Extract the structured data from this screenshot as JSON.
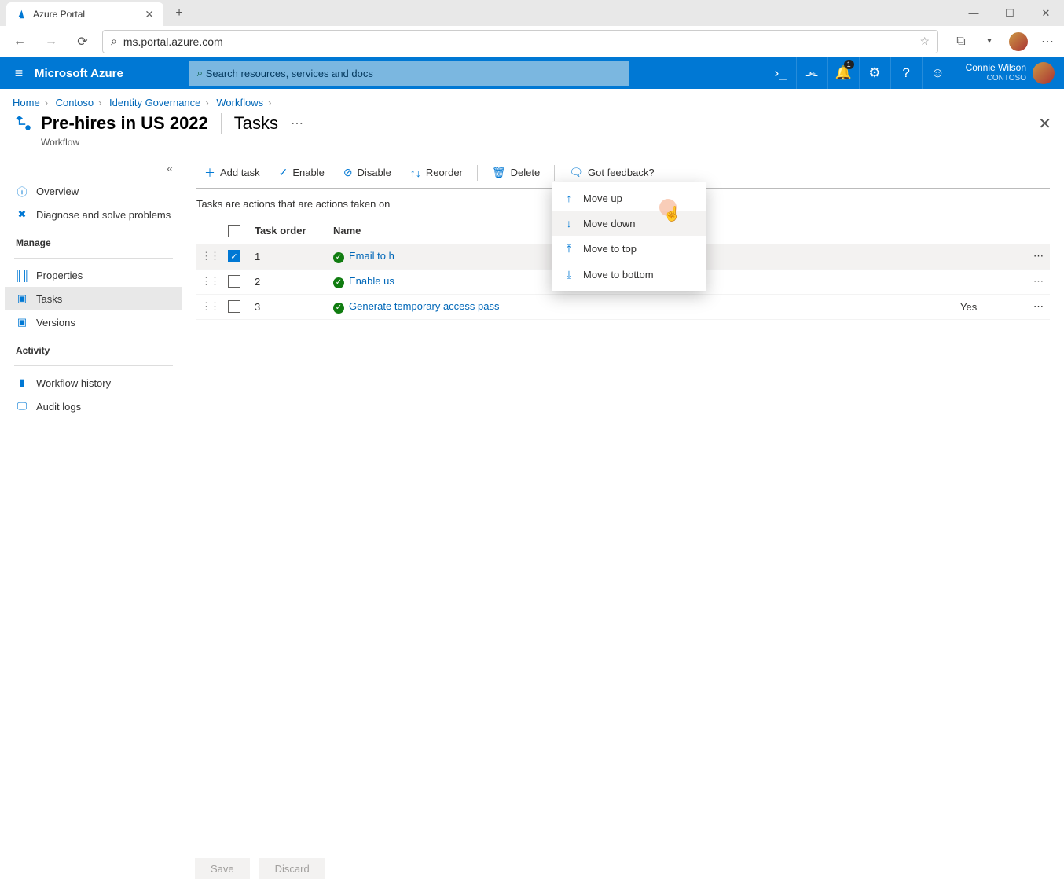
{
  "browser": {
    "tab_title": "Azure Portal",
    "url": "ms.portal.azure.com"
  },
  "header": {
    "brand": "Microsoft Azure",
    "search_placeholder": "Search resources, services and docs",
    "notification_badge": "1",
    "user_name": "Connie Wilson",
    "user_org": "CONTOSO"
  },
  "breadcrumbs": [
    "Home",
    "Contoso",
    "Identity Governance",
    "Workflows"
  ],
  "page": {
    "title": "Pre-hires in US 2022",
    "section": "Tasks",
    "subtitle": "Workflow"
  },
  "sidebar": {
    "overview": "Overview",
    "diagnose": "Diagnose and solve problems",
    "group_manage": "Manage",
    "properties": "Properties",
    "tasks": "Tasks",
    "versions": "Versions",
    "group_activity": "Activity",
    "history": "Workflow history",
    "audit": "Audit logs"
  },
  "commands": {
    "add_task": "Add task",
    "enable": "Enable",
    "disable": "Disable",
    "reorder": "Reorder",
    "delete": "Delete",
    "feedback": "Got feedback?"
  },
  "reorder_menu": {
    "move_up": "Move up",
    "move_down": "Move down",
    "move_top": "Move to top",
    "move_bottom": "Move to bottom"
  },
  "table": {
    "description": "Tasks are actions that are actions taken on",
    "col_order": "Task order",
    "col_name": "Name",
    "rows": [
      {
        "order": "1",
        "name": "Email to h",
        "extra": "",
        "selected": true
      },
      {
        "order": "2",
        "name": "Enable us",
        "extra": "",
        "selected": false
      },
      {
        "order": "3",
        "name": "Generate temporary access pass",
        "extra": "Yes",
        "selected": false
      }
    ]
  },
  "footer": {
    "save": "Save",
    "discard": "Discard"
  }
}
